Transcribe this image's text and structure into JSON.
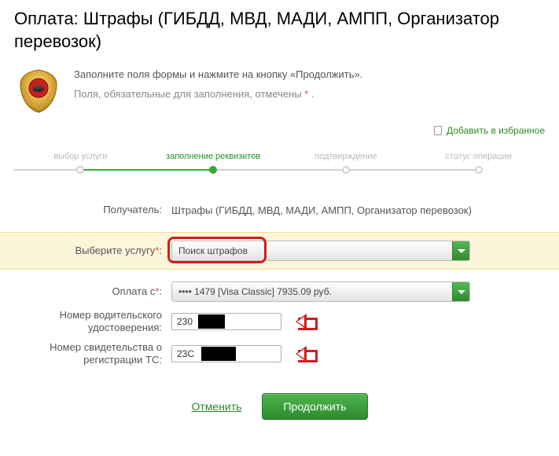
{
  "title": "Оплата: Штрафы (ГИБДД, МВД, МАДИ, АМПП, Организатор перевозок)",
  "intro": {
    "line1": "Заполните поля формы и нажмите на кнопку «Продолжить».",
    "line2_prefix": "Поля, обязательные для заполнения, отмечены ",
    "star": "*",
    "line2_suffix": " ."
  },
  "favorite_link": "Добавить в избранное",
  "stepper": {
    "steps": [
      {
        "label": "выбор услуги",
        "active": false
      },
      {
        "label": "заполнение реквизитов",
        "active": true
      },
      {
        "label": "подтверждение",
        "active": false
      },
      {
        "label": "статус операции",
        "active": false
      }
    ]
  },
  "form": {
    "recipient": {
      "label": "Получатель:",
      "value": "Штрафы (ГИБДД, МВД, МАДИ, АМПП, Организатор перевозок)"
    },
    "service": {
      "label": "Выберите услугу",
      "star": "*",
      "colon": ":",
      "selected": "Поиск штрафов"
    },
    "pay_from": {
      "label": "Оплата с",
      "star": "*",
      "colon": ":",
      "selected": "•••• 1479 [Visa Classic] 7935.09 руб."
    },
    "driver_license": {
      "label": "Номер водительского удостоверения:",
      "value": "230        70"
    },
    "vehicle_cert": {
      "label": "Номер свидетельства о регистрации ТС:",
      "value": "23C         4"
    }
  },
  "actions": {
    "cancel": "Отменить",
    "continue": "Продолжить"
  },
  "colors": {
    "accent_green": "#2e8a2e",
    "annotation_red": "#cf1d1d",
    "highlight_bg": "#fdf5da"
  }
}
